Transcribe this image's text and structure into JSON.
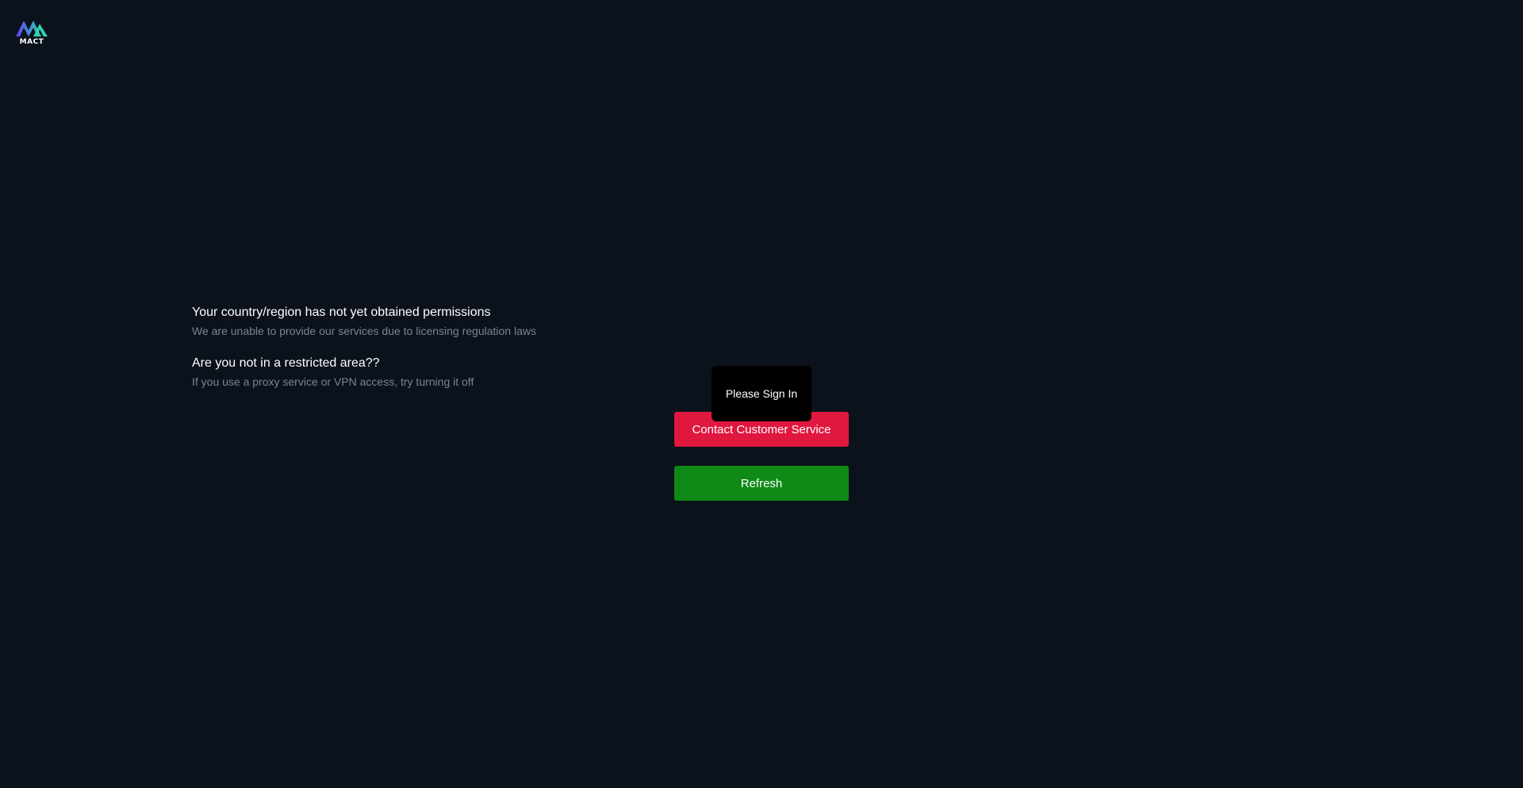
{
  "header": {
    "logo_text": "MACT"
  },
  "notice": {
    "title": "Your country/region has not yet obtained permissions",
    "subtitle": "We are unable to provide our services due to licensing regulation laws"
  },
  "restricted": {
    "title": "Are you not in a restricted area??",
    "subtitle": "If you use a proxy service or VPN access, try turning it off"
  },
  "actions": {
    "contact_label": "Contact Customer Service",
    "refresh_label": "Refresh"
  },
  "tooltip": {
    "text": "Please Sign In"
  },
  "colors": {
    "background": "#0b121b",
    "contact_button": "#e0173f",
    "refresh_button": "#0f8a16",
    "tooltip_bg": "#000000",
    "subtitle_text": "#7b8591"
  }
}
